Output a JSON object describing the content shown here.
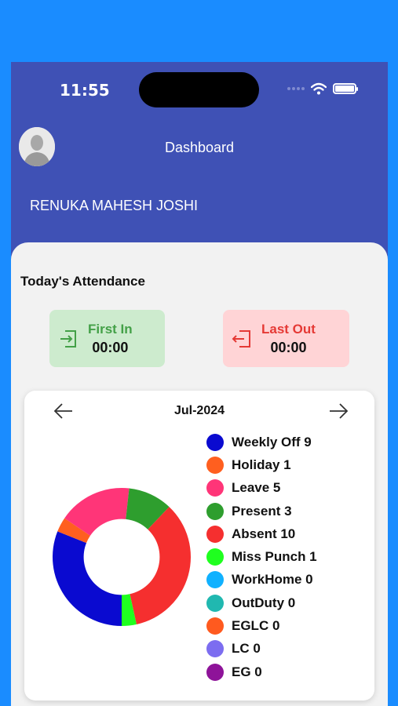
{
  "status_bar": {
    "time": "11:55"
  },
  "header": {
    "title": "Dashboard",
    "user_name": "RENUKA MAHESH JOSHI"
  },
  "attendance": {
    "title": "Today's Attendance",
    "first_in": {
      "label": "First In",
      "value": "00:00"
    },
    "last_out": {
      "label": "Last Out",
      "value": "00:00"
    }
  },
  "chart": {
    "month": "Jul-2024",
    "prev_icon": "arrow-left-icon",
    "next_icon": "arrow-right-icon",
    "legend": [
      {
        "label": "Weekly Off 9",
        "color": "#0a0ad0"
      },
      {
        "label": "Holiday 1",
        "color": "#ff5f1f"
      },
      {
        "label": "Leave 5",
        "color": "#ff3578"
      },
      {
        "label": "Present 3",
        "color": "#2e9e2e"
      },
      {
        "label": "Absent 10",
        "color": "#f52f2f"
      },
      {
        "label": "Miss Punch 1",
        "color": "#1fff1f"
      },
      {
        "label": "WorkHome 0",
        "color": "#10b1ff"
      },
      {
        "label": "OutDuty 0",
        "color": "#20b8b0"
      },
      {
        "label": "EGLC 0",
        "color": "#ff5a1f"
      },
      {
        "label": "LC 0",
        "color": "#7c6df0"
      },
      {
        "label": "EG 0",
        "color": "#8e1399"
      }
    ]
  },
  "chart_data": {
    "type": "pie",
    "start_angle_deg": 90,
    "direction": "clockwise",
    "categories": [
      "Weekly Off",
      "Holiday",
      "Leave",
      "Present",
      "Absent",
      "Miss Punch",
      "WorkHome",
      "OutDuty",
      "EGLC",
      "LC",
      "EG"
    ],
    "values": [
      9,
      1,
      5,
      3,
      10,
      1,
      0,
      0,
      0,
      0,
      0
    ],
    "colors": [
      "#0a0ad0",
      "#ff5f1f",
      "#ff3578",
      "#2e9e2e",
      "#f52f2f",
      "#1fff1f",
      "#10b1ff",
      "#20b8b0",
      "#ff5a1f",
      "#7c6df0",
      "#8e1399"
    ],
    "hole_ratio": 0.55
  }
}
